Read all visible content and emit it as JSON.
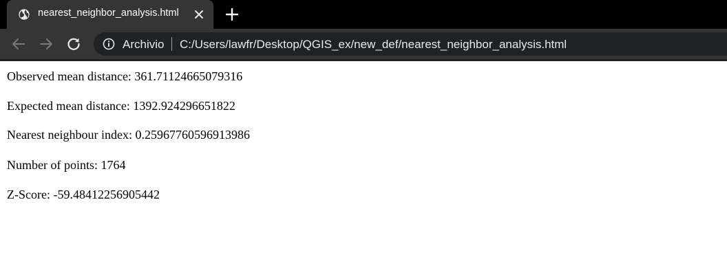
{
  "browser": {
    "tab": {
      "title": "nearest_neighbor_analysis.html",
      "favicon": "globe-icon"
    },
    "toolbar": {
      "security_label": "Archivio",
      "url": "C:/Users/lawfr/Desktop/QGIS_ex/new_def/nearest_neighbor_analysis.html"
    },
    "colors": {
      "tabstrip": "#000000",
      "toolbar": "#353535",
      "omnibox": "#202124",
      "text": "#e8eaed"
    }
  },
  "results": [
    "Observed mean distance: 361.71124665079316",
    "Expected mean distance: 1392.924296651822",
    "Nearest neighbour index: 0.25967760596913986",
    "Number of points: 1764",
    "Z-Score: -59.48412256905442"
  ]
}
